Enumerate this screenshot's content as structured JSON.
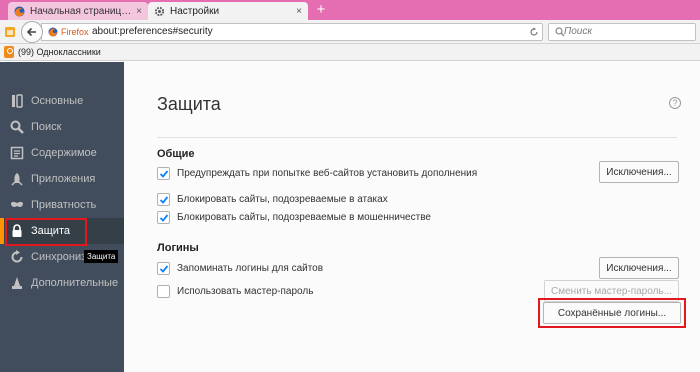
{
  "tabs": [
    {
      "label": "Начальная страница Mo...",
      "close": "×",
      "active": false,
      "icon": "firefox-icon"
    },
    {
      "label": "Настройки",
      "close": "×",
      "active": true,
      "icon": "gear-icon"
    }
  ],
  "new_tab_label": "+",
  "navbar": {
    "identity_label": "Firefox",
    "url": "about:preferences#security",
    "search_placeholder": "Поиск"
  },
  "bookmarks": [
    {
      "label": "(99) Одноклассники",
      "icon": "odnoklassniki-icon"
    }
  ],
  "sidebar": {
    "items": [
      {
        "label": "Основные",
        "icon": "general-icon",
        "selected": false
      },
      {
        "label": "Поиск",
        "icon": "search-icon",
        "selected": false
      },
      {
        "label": "Содержимое",
        "icon": "content-icon",
        "selected": false
      },
      {
        "label": "Приложения",
        "icon": "applications-icon",
        "selected": false
      },
      {
        "label": "Приватность",
        "icon": "privacy-mask-icon",
        "selected": false
      },
      {
        "label": "Защита",
        "icon": "lock-icon",
        "selected": true
      },
      {
        "label": "Синхронизация",
        "icon": "sync-icon",
        "selected": false
      },
      {
        "label": "Дополнительные",
        "icon": "advanced-wizard-icon",
        "selected": false
      }
    ],
    "tooltip": "Защита"
  },
  "main": {
    "title": "Защита",
    "help": "?",
    "general": {
      "heading": "Общие",
      "warn_addons": {
        "label": "Предупреждать при попытке веб-сайтов установить дополнения",
        "checked": true
      },
      "exceptions_button": "Исключения...",
      "block_attack": {
        "label": "Блокировать сайты, подозреваемые в атаках",
        "checked": true
      },
      "block_fraud": {
        "label": "Блокировать сайты, подозреваемые в мошенничестве",
        "checked": true
      }
    },
    "logins": {
      "heading": "Логины",
      "remember": {
        "label": "Запоминать логины для сайтов",
        "checked": true
      },
      "exceptions_button": "Исключения...",
      "master_password": {
        "label": "Использовать мастер-пароль",
        "checked": false
      },
      "change_master_button": "Сменить мастер-пароль...",
      "saved_logins_button": "Сохранённые логины..."
    }
  },
  "colors": {
    "tabbar": "#e46eb1",
    "sidebar_bg": "#414d5c",
    "selected_indicator": "#ff9500",
    "highlight_box": "#e3171d",
    "checkmark": "#0a84ff"
  }
}
